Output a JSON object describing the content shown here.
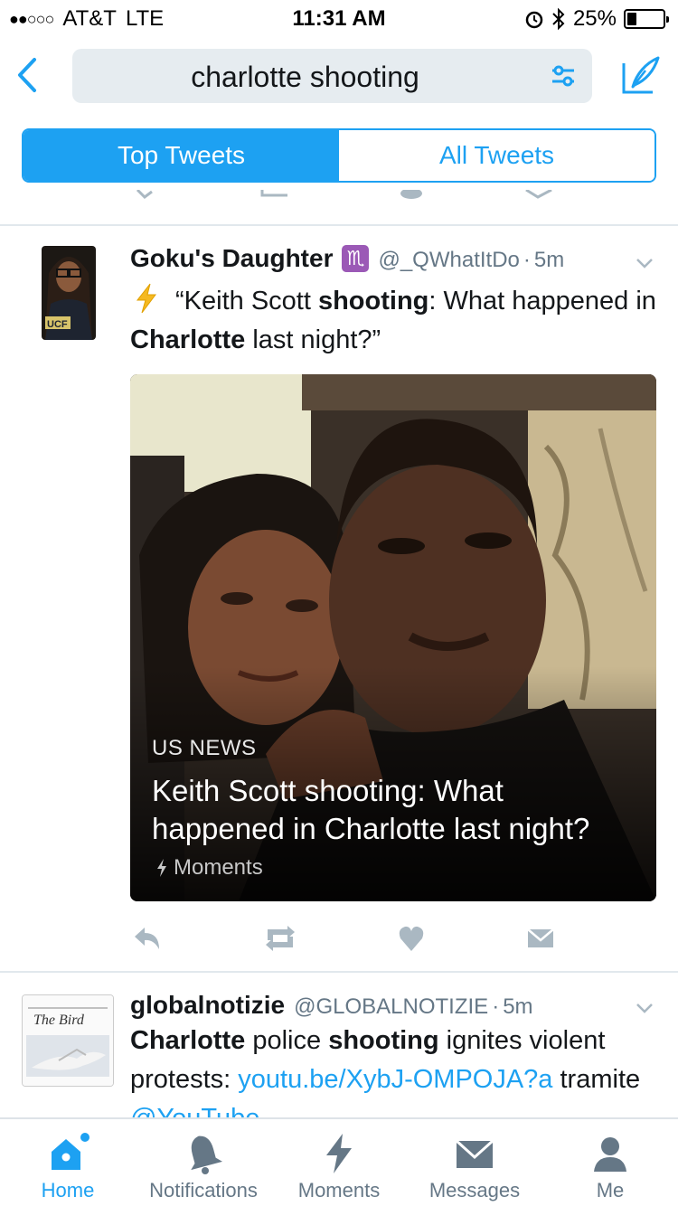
{
  "status_bar": {
    "signal": "●●○○○",
    "carrier": "AT&T",
    "network": "LTE",
    "time": "11:31 AM",
    "battery_percent": "25%",
    "battery_level": 0.25
  },
  "search": {
    "query": "charlotte shooting"
  },
  "tabs_filter": {
    "top": "Top Tweets",
    "all": "All Tweets",
    "active": "top"
  },
  "tweets": [
    {
      "name": "Goku's Daughter",
      "emoji": "♏",
      "handle": "@_QWhatItDo",
      "dot": "·",
      "time": "5m",
      "text_parts": [
        "“Keith Scott ",
        "shooting",
        ": What happened in ",
        "Charlotte",
        " last night?”"
      ],
      "card": {
        "category": "US NEWS",
        "headline": "Keith Scott shooting: What happened in Charlotte last night?",
        "source": "Moments"
      }
    },
    {
      "name": "globalnotizie",
      "handle": "@GLOBALNOTIZIE",
      "dot": "·",
      "time": "5m",
      "avatar_text": "The Bird",
      "text_parts": [
        "Charlotte",
        " police ",
        "shooting",
        " ignites violent protests: ",
        "youtu.be/XybJ-OMPOJA?a",
        " tramite ",
        "@YouTube"
      ]
    }
  ],
  "tab_bar": {
    "items": [
      "Home",
      "Notifications",
      "Moments",
      "Messages",
      "Me"
    ],
    "active": "Home"
  },
  "colors": {
    "accent": "#1da1f2",
    "secondary_text": "#657786",
    "icon_gray": "#aab8c2"
  }
}
